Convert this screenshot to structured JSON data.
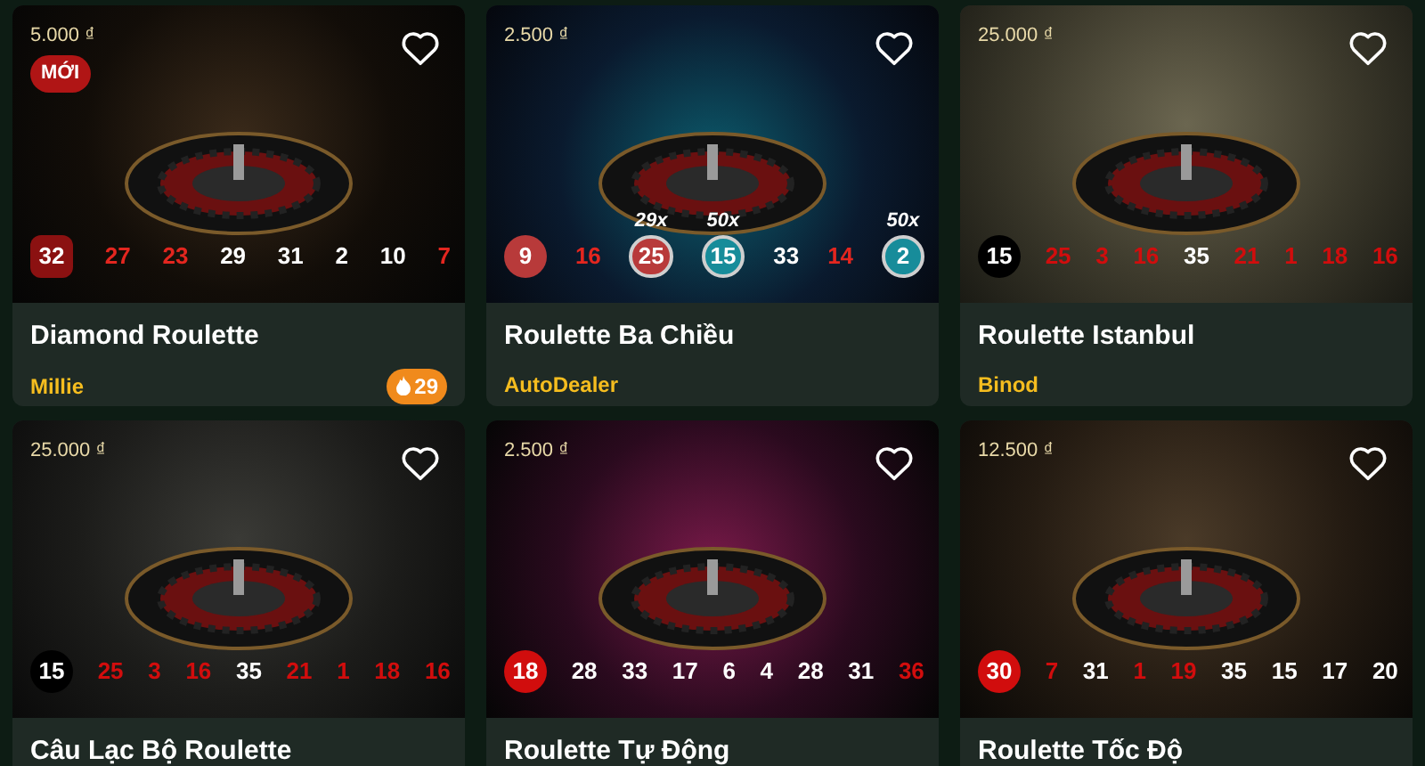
{
  "games": [
    {
      "title": "Diamond Roulette",
      "dealer": "Millie",
      "price": "5.000 ₫",
      "badge": "MỚI",
      "hot": "29",
      "favorite": false,
      "kind": "square",
      "results": [
        {
          "value": "32",
          "color": "#8b1111",
          "latest": true
        },
        {
          "value": "27",
          "color": "#e3261f",
          "latest": false
        },
        {
          "value": "23",
          "color": "#e3261f",
          "latest": false
        },
        {
          "value": "29",
          "color": "#ffffff",
          "latest": false
        },
        {
          "value": "31",
          "color": "#ffffff",
          "latest": false
        },
        {
          "value": "2",
          "color": "#ffffff",
          "latest": false
        },
        {
          "value": "10",
          "color": "#ffffff",
          "latest": false
        },
        {
          "value": "7",
          "color": "#e3261f",
          "latest": false
        }
      ]
    },
    {
      "title": "Roulette Ba Chiều",
      "dealer": "AutoDealer",
      "price": "2.500 ₫",
      "favorite": false,
      "kind": "circle",
      "results": [
        {
          "value": "9",
          "color": "#b83a3a",
          "latest": true,
          "ringed": false
        },
        {
          "value": "16",
          "color": "#e3261f",
          "latest": false,
          "ringed": false
        },
        {
          "value": "25",
          "color": "#b83a3a",
          "latest": false,
          "ringed": true,
          "multiplier": "29x"
        },
        {
          "value": "15",
          "color": "#178c9a",
          "latest": false,
          "ringed": true,
          "multiplier": "50x"
        },
        {
          "value": "33",
          "color": "#ffffff",
          "latest": false,
          "ringed": false
        },
        {
          "value": "14",
          "color": "#e3261f",
          "latest": false,
          "ringed": false
        },
        {
          "value": "2",
          "color": "#178c9a",
          "latest": false,
          "ringed": true,
          "multiplier": "50x"
        }
      ]
    },
    {
      "title": "Roulette Istanbul",
      "dealer": "Binod",
      "price": "25.000 ₫",
      "favorite": false,
      "kind": "circle",
      "results": [
        {
          "value": "15",
          "color": "#000000",
          "latest": true
        },
        {
          "value": "25",
          "color": "#d10d0d",
          "latest": false
        },
        {
          "value": "3",
          "color": "#d10d0d",
          "latest": false
        },
        {
          "value": "16",
          "color": "#d10d0d",
          "latest": false
        },
        {
          "value": "35",
          "color": "#ffffff",
          "latest": false
        },
        {
          "value": "21",
          "color": "#d10d0d",
          "latest": false
        },
        {
          "value": "1",
          "color": "#d10d0d",
          "latest": false
        },
        {
          "value": "18",
          "color": "#d10d0d",
          "latest": false
        },
        {
          "value": "16",
          "color": "#d10d0d",
          "latest": false
        }
      ]
    },
    {
      "title": "Câu Lạc Bộ Roulette",
      "price": "25.000 ₫",
      "favorite": false,
      "kind": "circle",
      "results": [
        {
          "value": "15",
          "color": "#000000",
          "latest": true
        },
        {
          "value": "25",
          "color": "#d10d0d",
          "latest": false
        },
        {
          "value": "3",
          "color": "#d10d0d",
          "latest": false
        },
        {
          "value": "16",
          "color": "#d10d0d",
          "latest": false
        },
        {
          "value": "35",
          "color": "#ffffff",
          "latest": false
        },
        {
          "value": "21",
          "color": "#d10d0d",
          "latest": false
        },
        {
          "value": "1",
          "color": "#d10d0d",
          "latest": false
        },
        {
          "value": "18",
          "color": "#d10d0d",
          "latest": false
        },
        {
          "value": "16",
          "color": "#d10d0d",
          "latest": false
        }
      ]
    },
    {
      "title": "Roulette Tự Động",
      "price": "2.500 ₫",
      "favorite": false,
      "kind": "circle",
      "results": [
        {
          "value": "18",
          "color": "#d10d0d",
          "latest": true
        },
        {
          "value": "28",
          "color": "#ffffff",
          "latest": false
        },
        {
          "value": "33",
          "color": "#ffffff",
          "latest": false
        },
        {
          "value": "17",
          "color": "#ffffff",
          "latest": false
        },
        {
          "value": "6",
          "color": "#ffffff",
          "latest": false
        },
        {
          "value": "4",
          "color": "#ffffff",
          "latest": false
        },
        {
          "value": "28",
          "color": "#ffffff",
          "latest": false
        },
        {
          "value": "31",
          "color": "#ffffff",
          "latest": false
        },
        {
          "value": "36",
          "color": "#d10d0d",
          "latest": false
        }
      ]
    },
    {
      "title": "Roulette Tốc Độ",
      "price": "12.500 ₫",
      "favorite": false,
      "kind": "circle",
      "results": [
        {
          "value": "30",
          "color": "#d10d0d",
          "latest": true
        },
        {
          "value": "7",
          "color": "#d10d0d",
          "latest": false
        },
        {
          "value": "31",
          "color": "#ffffff",
          "latest": false
        },
        {
          "value": "1",
          "color": "#d10d0d",
          "latest": false
        },
        {
          "value": "19",
          "color": "#d10d0d",
          "latest": false
        },
        {
          "value": "35",
          "color": "#ffffff",
          "latest": false
        },
        {
          "value": "15",
          "color": "#ffffff",
          "latest": false
        },
        {
          "value": "17",
          "color": "#ffffff",
          "latest": false
        },
        {
          "value": "20",
          "color": "#ffffff",
          "latest": false
        }
      ]
    }
  ]
}
